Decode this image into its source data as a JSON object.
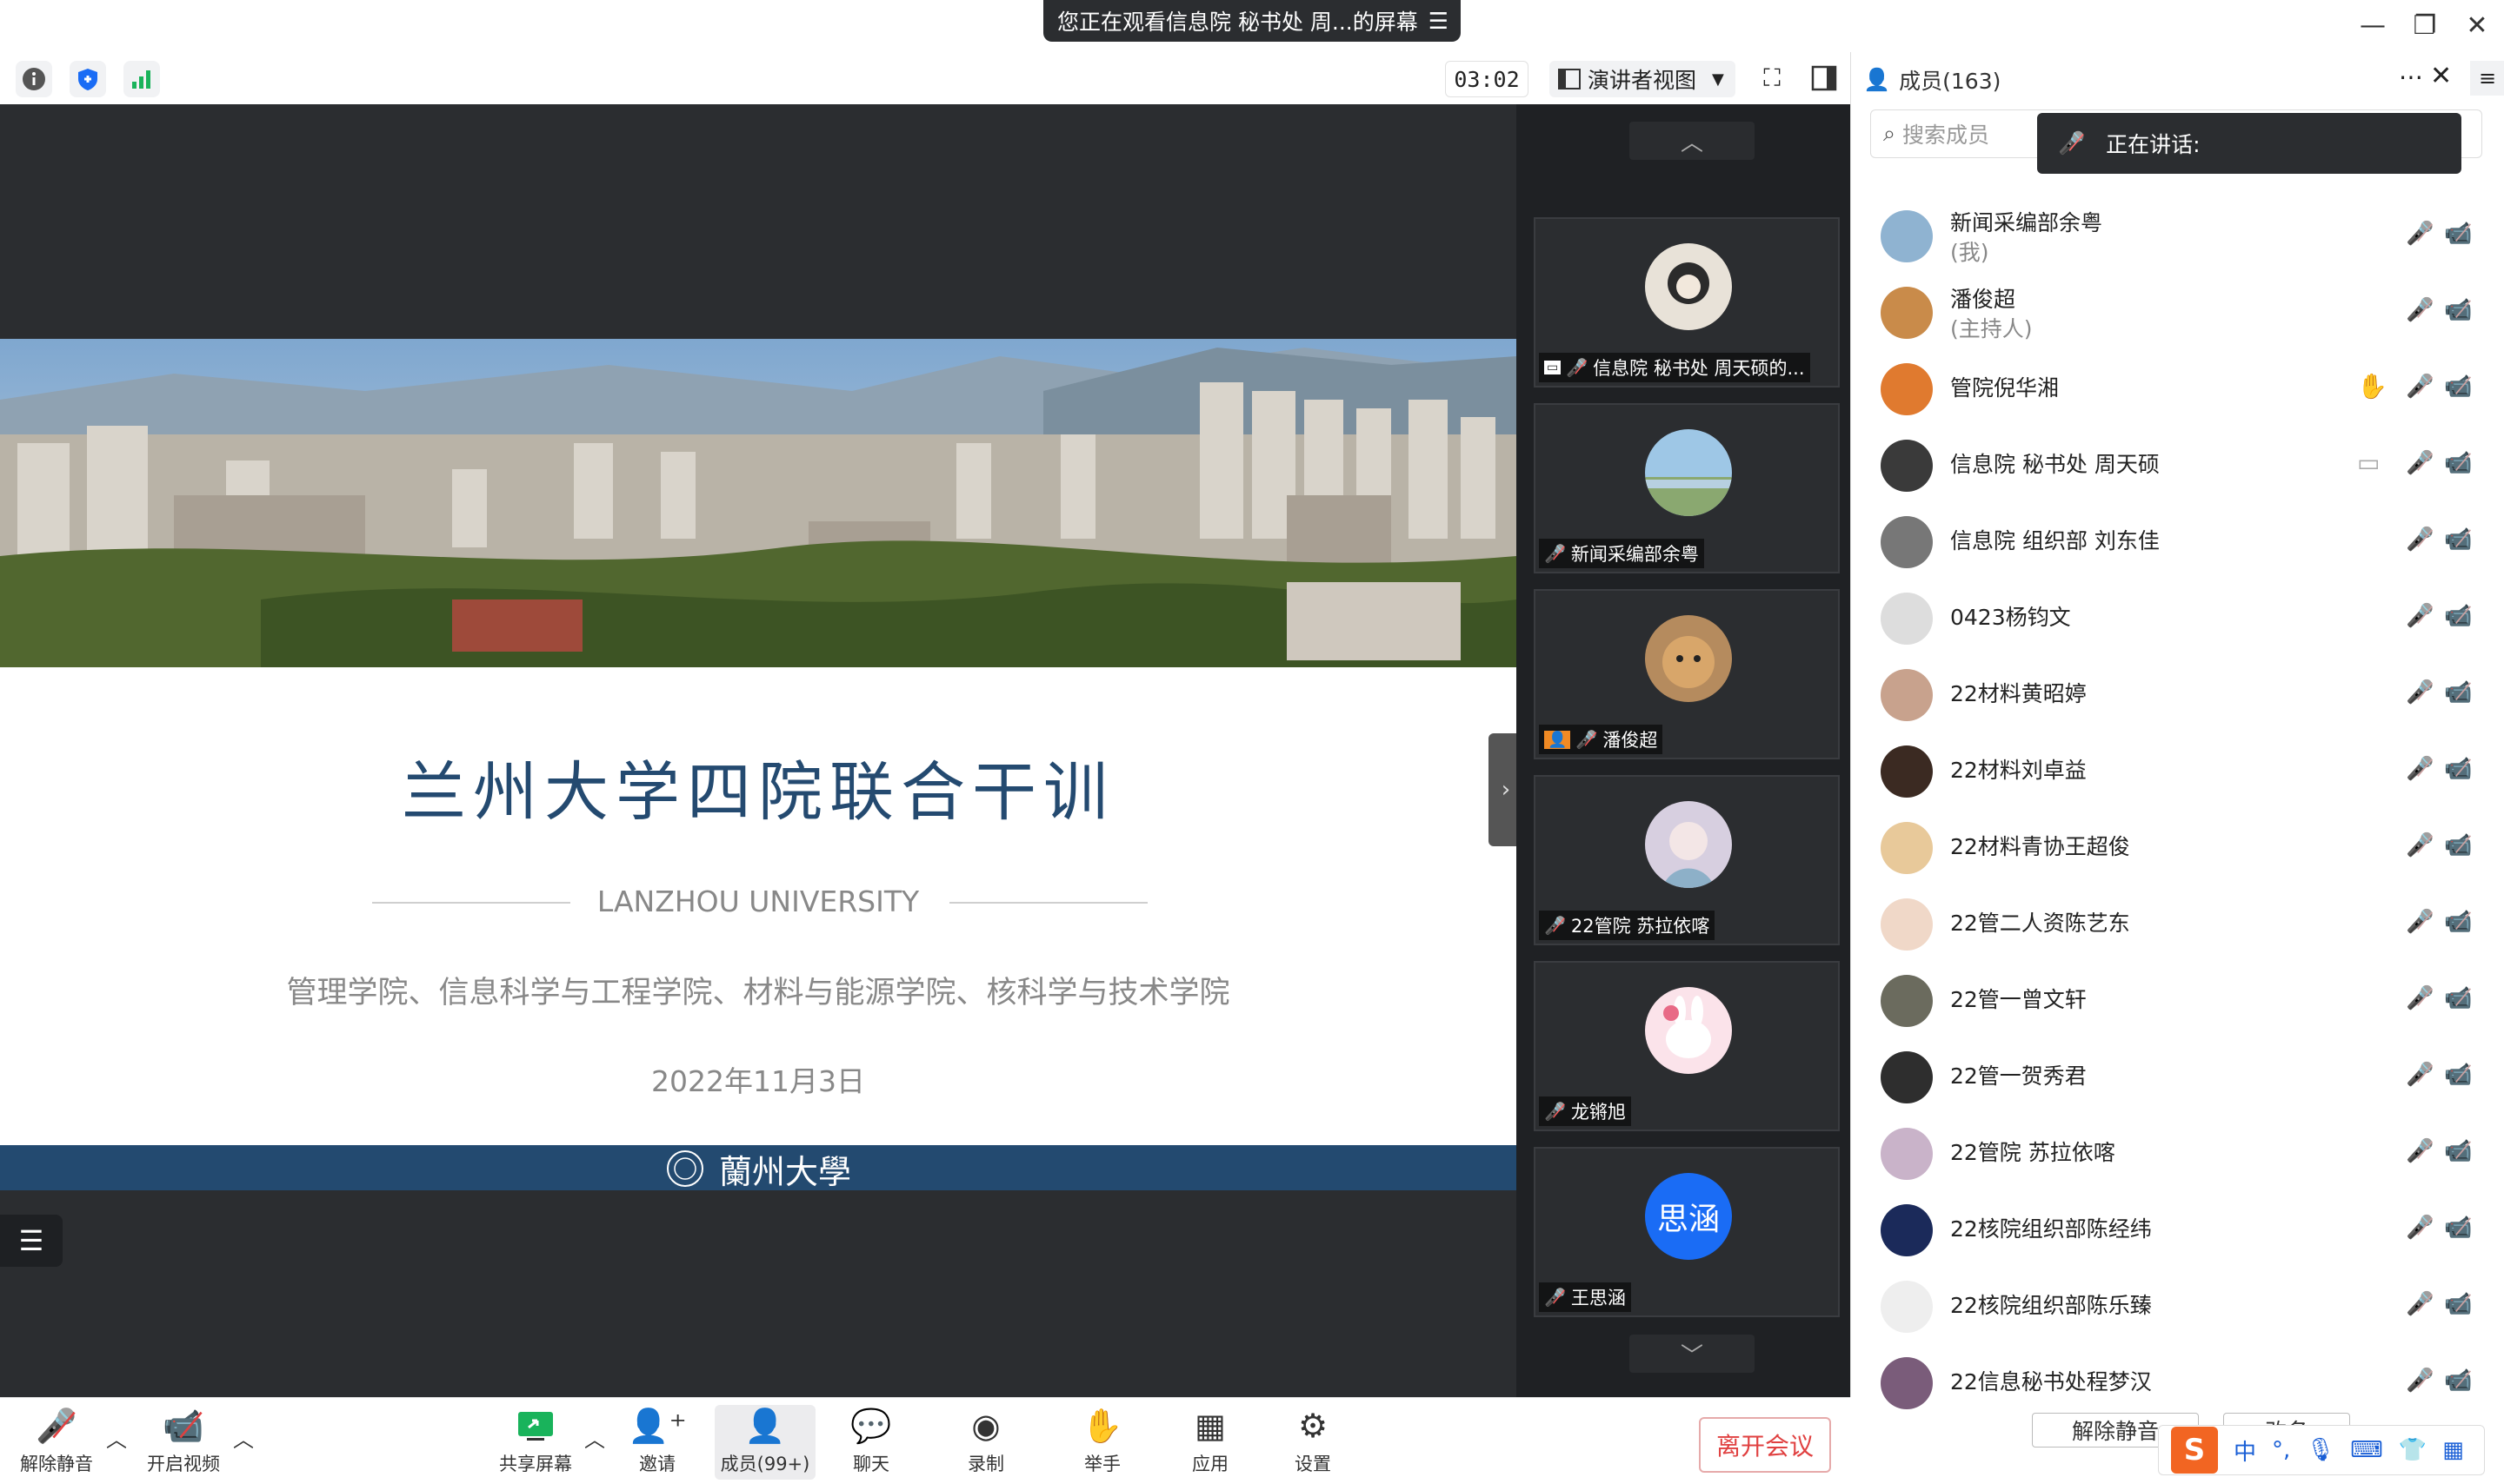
{
  "window": {
    "share_banner": "您正在观看信息院 秘书处 周...的屏幕",
    "minimize": "—",
    "restore": "❐",
    "close": "✕"
  },
  "toolbar": {
    "timer": "03:02",
    "view_mode": "演讲者视图"
  },
  "slide": {
    "title": "兰州大学四院联合干训",
    "subtitle": "LANZHOU UNIVERSITY",
    "colleges": "管理学院、信息科学与工程学院、材料与能源学院、核科学与技术学院",
    "date": "2022年11月3日",
    "footer_text": "蘭州大學"
  },
  "video_strip": [
    {
      "name": "信息院 秘书处 周天硕的...",
      "sharing": true
    },
    {
      "name": "新闻采编部余粤"
    },
    {
      "name": "潘俊超",
      "host_badge": true
    },
    {
      "name": "22管院 苏拉依喀"
    },
    {
      "name": "龙锵旭"
    },
    {
      "name": "王思涵",
      "avatar_text": "思涵"
    }
  ],
  "panel": {
    "title": "成员(163)",
    "search_placeholder": "搜索成员",
    "speaking_label": "正在讲话:",
    "members": [
      {
        "name": "新闻采编部余粤",
        "role": "(我)"
      },
      {
        "name": "潘俊超",
        "role": "(主持人)"
      },
      {
        "name": "管院倪华湘",
        "hand": true
      },
      {
        "name": "信息院 秘书处 周天硕",
        "sharing": true
      },
      {
        "name": " 信息院 组织部 刘东佳"
      },
      {
        "name": "0423杨钧文"
      },
      {
        "name": "22材料黄昭婷"
      },
      {
        "name": "22材料刘卓益"
      },
      {
        "name": "22材料青协王超俊"
      },
      {
        "name": "22管二人资陈艺东"
      },
      {
        "name": "22管一曾文轩"
      },
      {
        "name": "22管一贺秀君"
      },
      {
        "name": "22管院 苏拉依喀"
      },
      {
        "name": "22核院组织部陈经纬"
      },
      {
        "name": "22核院组织部陈乐臻"
      },
      {
        "name": "22信息秘书处程梦汉"
      }
    ],
    "unmute_all": "解除静音",
    "rename": "改名"
  },
  "ime": {
    "logo": "S",
    "lang": "中",
    "punct": "°,"
  },
  "controls": {
    "unmute": "解除静音",
    "start_video": "开启视频",
    "share_screen": "共享屏幕",
    "invite": "邀请",
    "members": "成员(99+)",
    "chat": "聊天",
    "record": "录制",
    "raise_hand": "举手",
    "apps": "应用",
    "settings": "设置",
    "leave": "离开会议"
  },
  "colors": {
    "accent": "#1a6cf5",
    "slide_title": "#244a70",
    "leave_red": "#e04040"
  }
}
